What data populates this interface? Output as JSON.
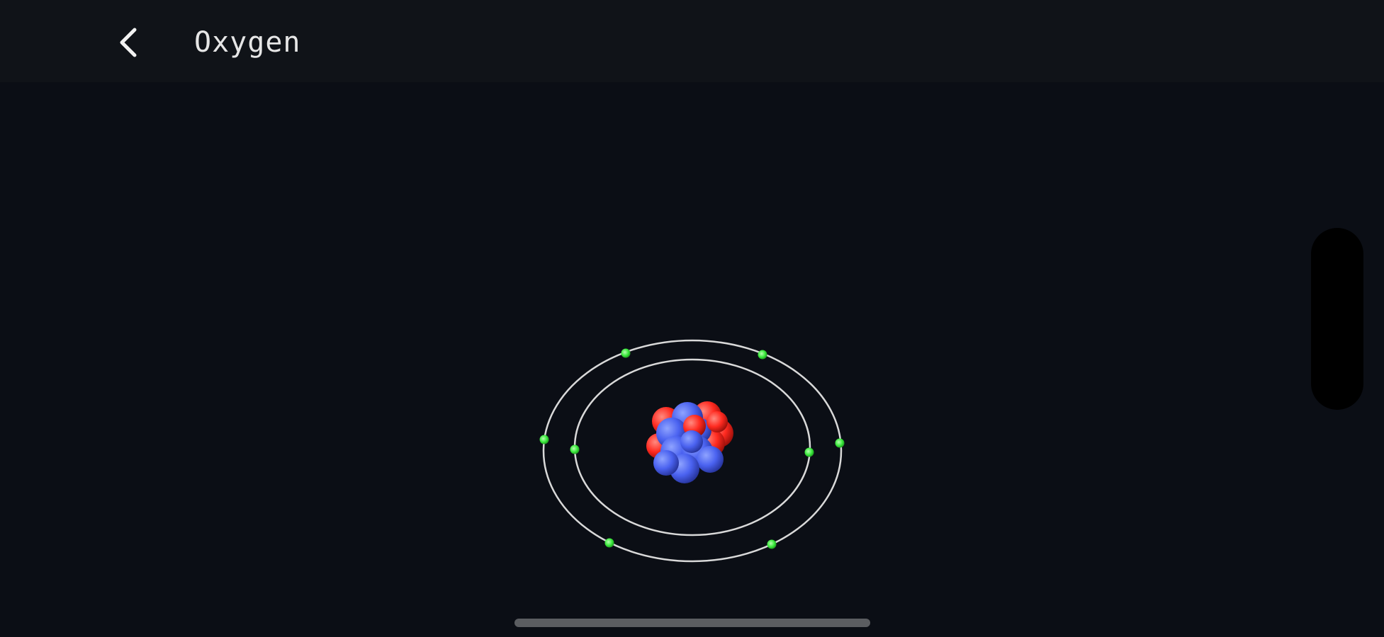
{
  "header": {
    "title": "Oxygen",
    "back_icon": "chevron-left-icon"
  },
  "atom": {
    "element": "Oxygen",
    "shells": [
      {
        "name": "inner-shell",
        "electrons": 2
      },
      {
        "name": "outer-shell",
        "electrons": 6
      }
    ],
    "nucleus": {
      "protons": 8,
      "neutrons": 8
    },
    "colors": {
      "proton": "#ff3b30",
      "neutron": "#4a62f0",
      "electron": "#38e83a",
      "orbit": "#d9d9d9"
    }
  },
  "colors": {
    "background": "#0b0e15",
    "top_bar": "#101318",
    "text": "#e6e6e6",
    "home_indicator": "#5b5d61"
  }
}
